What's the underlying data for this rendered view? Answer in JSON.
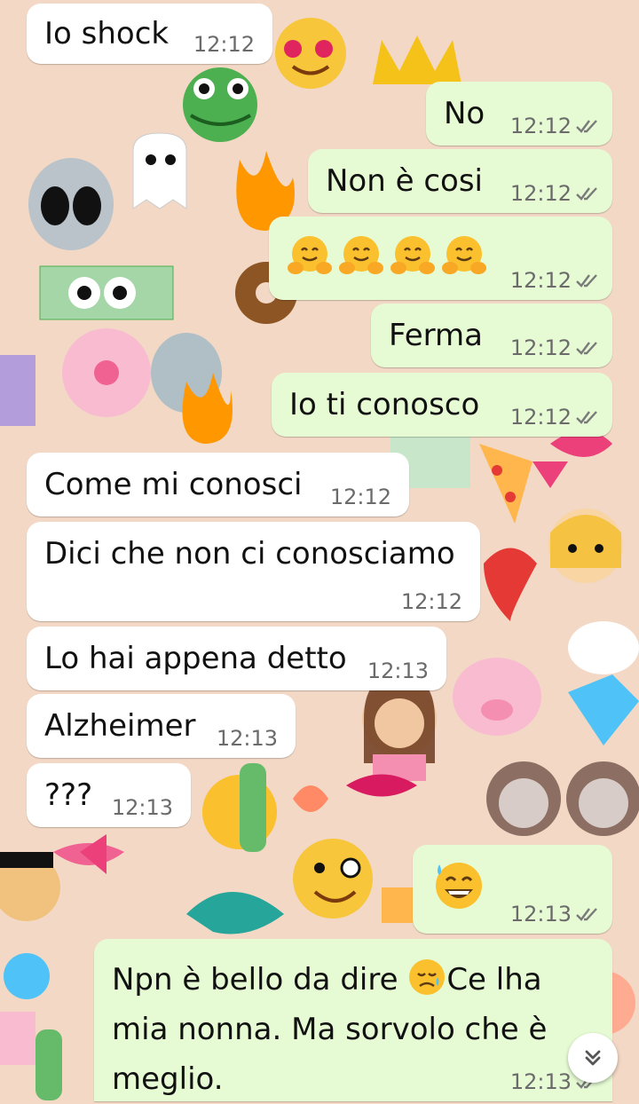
{
  "wallpaper": {
    "description_icon": "emoji-collage-wallpaper"
  },
  "messages": [
    {
      "dir": "in",
      "text": "Io shock",
      "time": "12:12"
    },
    {
      "dir": "out",
      "text": "No",
      "time": "12:12",
      "status": "read-check-icon"
    },
    {
      "dir": "out",
      "text": "Non è cosi",
      "time": "12:12",
      "status": "read-check-icon"
    },
    {
      "dir": "out",
      "emojis": [
        "hugging-face-emoji",
        "hugging-face-emoji",
        "hugging-face-emoji",
        "hugging-face-emoji"
      ],
      "time": "12:12",
      "status": "read-check-icon"
    },
    {
      "dir": "out",
      "text": "Ferma",
      "time": "12:12",
      "status": "read-check-icon"
    },
    {
      "dir": "out",
      "text": "Io ti conosco",
      "time": "12:12",
      "status": "read-check-icon"
    },
    {
      "dir": "in",
      "text": "Come mi conosci",
      "time": "12:12"
    },
    {
      "dir": "in",
      "text": "Dici che non ci conosciamo",
      "time": "12:12"
    },
    {
      "dir": "in",
      "text": "Lo hai appena detto",
      "time": "12:13"
    },
    {
      "dir": "in",
      "text": "Alzheimer",
      "time": "12:13"
    },
    {
      "dir": "in",
      "text": "???",
      "time": "12:13"
    },
    {
      "dir": "out",
      "emojis": [
        "grinning-sweat-emoji"
      ],
      "time": "12:13",
      "status": "read-check-icon"
    },
    {
      "dir": "out",
      "text_parts": [
        "Npn è bello da dire ",
        "Ce lha mia nonna. Ma sorvolo che è meglio."
      ],
      "inline_emoji": "sad-relieved-emoji",
      "time": "12:13",
      "status": "read-check-icon"
    }
  ],
  "controls": {
    "scroll_down_icon": "double-chevron-down-icon"
  },
  "colors": {
    "incoming": "#ffffff",
    "outgoing": "#e6fbd4",
    "tick": "#7a7a7a"
  }
}
